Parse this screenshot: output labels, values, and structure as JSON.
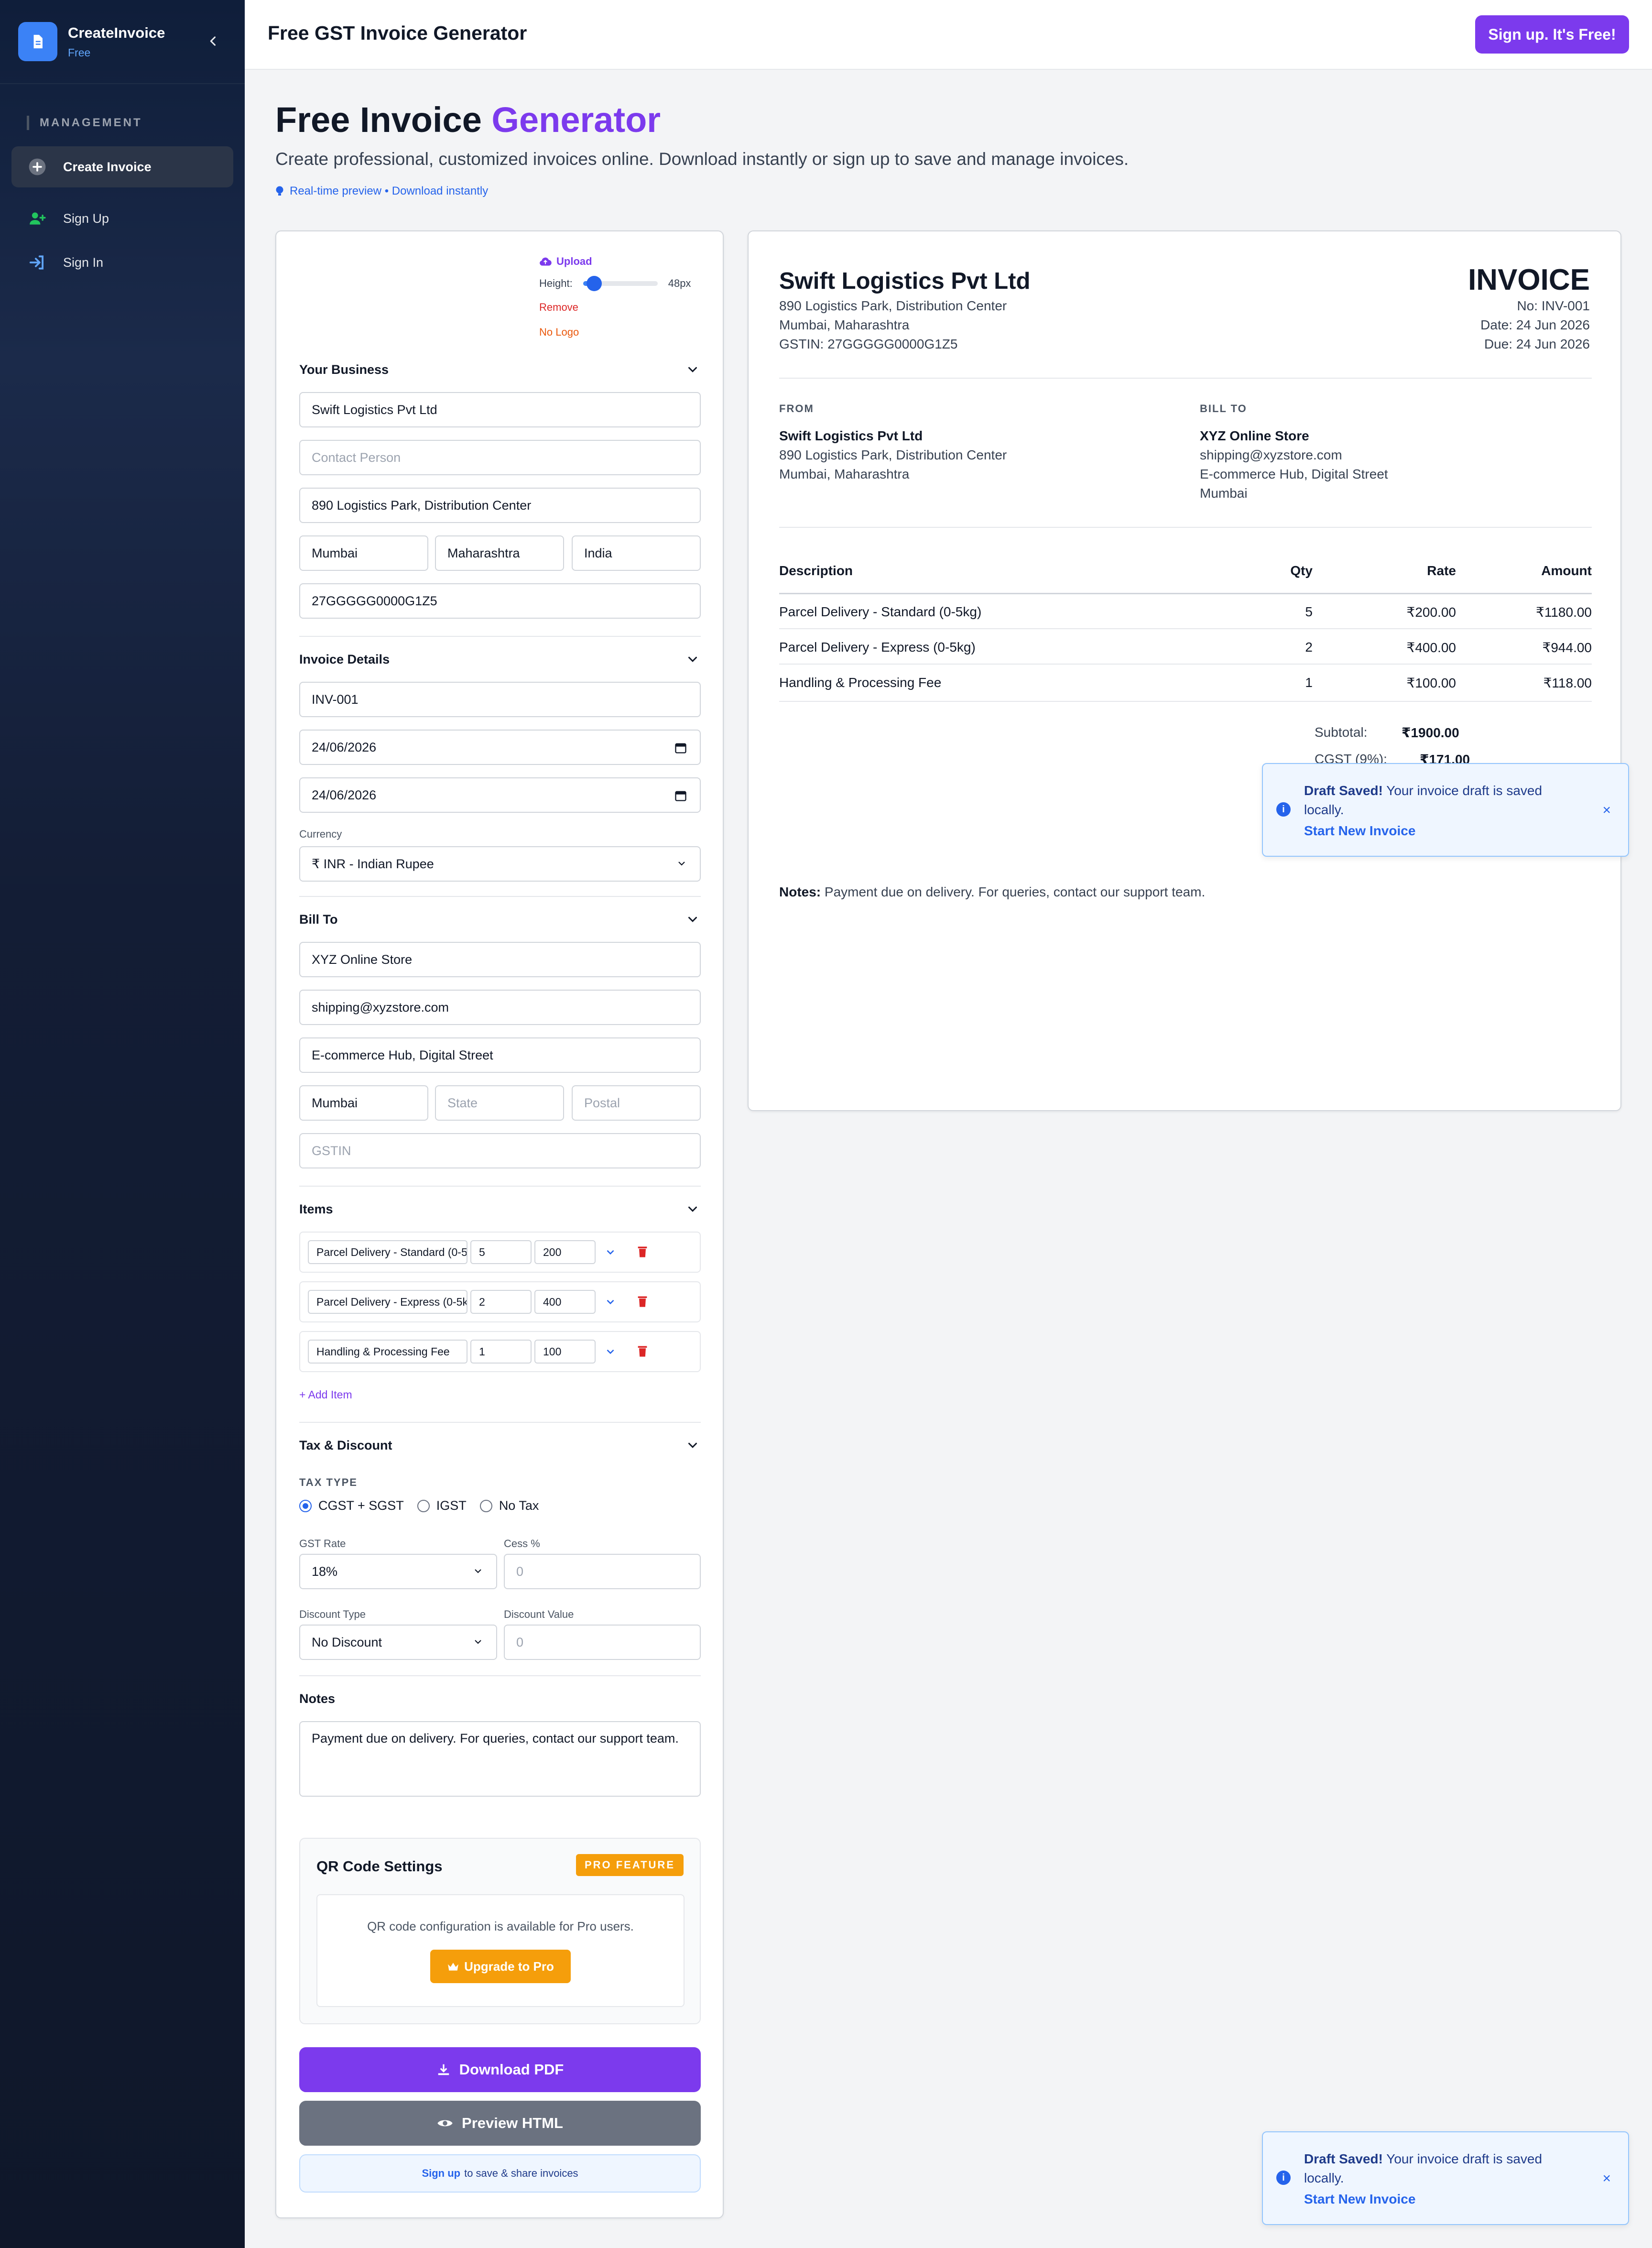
{
  "sidebar": {
    "brand": "CreateInvoice",
    "plan": "Free",
    "section": "MANAGEMENT",
    "items": [
      {
        "label": "Create Invoice"
      },
      {
        "label": "Sign Up"
      },
      {
        "label": "Sign In"
      }
    ]
  },
  "topbar": {
    "title": "Free GST Invoice Generator",
    "cta": "Sign up. It's Free!"
  },
  "hero": {
    "title_main": "Free Invoice ",
    "title_accent": "Generator",
    "subtitle": "Create professional, customized invoices online. Download instantly or sign up to save and manage invoices.",
    "hint": "Real-time preview • Download instantly"
  },
  "logo": {
    "upload": "Upload",
    "height_label": "Height:",
    "height_value": "48px",
    "height_fraction": 0.15,
    "remove": "Remove",
    "no_logo": "No Logo"
  },
  "business": {
    "title": "Your Business",
    "name": "Swift Logistics Pvt Ltd",
    "contact_placeholder": "Contact Person",
    "address": "890 Logistics Park, Distribution Center",
    "city": "Mumbai",
    "state": "Maharashtra",
    "country": "India",
    "gstin": "27GGGGG0000G1Z5"
  },
  "invoice": {
    "title": "Invoice Details",
    "number": "INV-001",
    "date": "24/06/2026",
    "due": "24/06/2026",
    "currency_label": "Currency",
    "currency": "₹ INR - Indian Rupee"
  },
  "billto": {
    "title": "Bill To",
    "name": "XYZ Online Store",
    "email": "shipping@xyzstore.com",
    "address": "E-commerce Hub, Digital Street",
    "city": "Mumbai",
    "state_placeholder": "State",
    "postal_placeholder": "Postal",
    "gstin_placeholder": "GSTIN"
  },
  "items": {
    "title": "Items",
    "rows": [
      {
        "desc": "Parcel Delivery - Standard (0-5kg)",
        "qty": "5",
        "rate": "200"
      },
      {
        "desc": "Parcel Delivery - Express (0-5kg)",
        "qty": "2",
        "rate": "400"
      },
      {
        "desc": "Handling & Processing Fee",
        "qty": "1",
        "rate": "100"
      }
    ],
    "add": "+ Add Item"
  },
  "tax": {
    "title": "Tax & Discount",
    "type_label": "TAX TYPE",
    "options": [
      "CGST + SGST",
      "IGST",
      "No Tax"
    ],
    "gst_label": "GST Rate",
    "gst_value": "18%",
    "cess_label": "Cess %",
    "cess_placeholder": "0",
    "disc_type_label": "Discount Type",
    "disc_type_value": "No Discount",
    "disc_value_label": "Discount Value",
    "disc_value_placeholder": "0"
  },
  "notes": {
    "title": "Notes",
    "text": "Payment due on delivery. For queries, contact our support team."
  },
  "qr": {
    "title": "QR Code Settings",
    "badge": "PRO FEATURE",
    "message": "QR code configuration is available for Pro users.",
    "button": "Upgrade to Pro"
  },
  "actions": {
    "pdf": "Download PDF",
    "preview": "Preview HTML",
    "signup_link": "Sign up",
    "signup_rest": "to save & share invoices"
  },
  "preview": {
    "company": "Swift Logistics Pvt Ltd",
    "addr1": "890 Logistics Park, Distribution Center",
    "addr2": "Mumbai, Maharashtra",
    "gstin": "GSTIN: 27GGGGG0000G1Z5",
    "heading": "INVOICE",
    "no": "No: INV-001",
    "date": "Date: 24 Jun 2026",
    "due": "Due: 24 Jun 2026",
    "from_label": "FROM",
    "billto_label": "BILL TO",
    "from": [
      "Swift Logistics Pvt Ltd",
      "890 Logistics Park, Distribution Center",
      "Mumbai, Maharashtra"
    ],
    "to": [
      "XYZ Online Store",
      "shipping@xyzstore.com",
      "E-commerce Hub, Digital Street",
      "Mumbai"
    ],
    "cols": [
      "Description",
      "Qty",
      "Rate",
      "Amount"
    ],
    "rows": [
      {
        "desc": "Parcel Delivery - Standard (0-5kg)",
        "qty": "5",
        "rate": "₹200.00",
        "amount": "₹1180.00"
      },
      {
        "desc": "Parcel Delivery - Express (0-5kg)",
        "qty": "2",
        "rate": "₹400.00",
        "amount": "₹944.00"
      },
      {
        "desc": "Handling & Processing Fee",
        "qty": "1",
        "rate": "₹100.00",
        "amount": "₹118.00"
      }
    ],
    "subtotal_label": "Subtotal:",
    "subtotal": "₹1900.00",
    "cgst_label": "CGST (9%):",
    "cgst": "₹171.00",
    "notes_label": "Notes:",
    "notes": "Payment due on delivery. For queries, contact our support team."
  },
  "toast": {
    "title": "Draft Saved!",
    "text": "Your invoice draft is saved locally.",
    "action": "Start New Invoice",
    "close": "×"
  },
  "colors": {
    "accent": "#7c3aed",
    "primary": "#2563eb",
    "sidebar": "#0f172a",
    "warning": "#f59e0b",
    "danger": "#dc2626"
  }
}
